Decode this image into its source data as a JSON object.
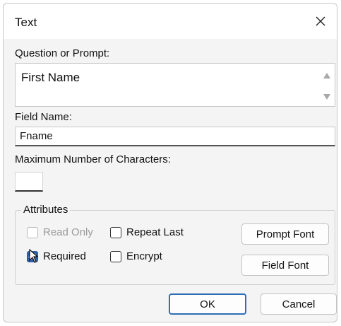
{
  "dialog": {
    "title": "Text",
    "close_icon": "close-icon"
  },
  "prompt": {
    "label": "Question or Prompt:",
    "value": "First Name"
  },
  "field_name": {
    "label": "Field Name:",
    "value": "Fname"
  },
  "max_chars": {
    "label": "Maximum Number of Characters:",
    "value": ""
  },
  "attributes": {
    "label": "Attributes",
    "read_only": {
      "label": "Read Only",
      "checked": false,
      "disabled": true
    },
    "repeat_last": {
      "label": "Repeat Last",
      "checked": false
    },
    "required": {
      "label": "Required",
      "checked": true
    },
    "encrypt": {
      "label": "Encrypt",
      "checked": false
    },
    "prompt_font_label": "Prompt Font",
    "field_font_label": "Field Font"
  },
  "buttons": {
    "ok": "OK",
    "cancel": "Cancel"
  },
  "colors": {
    "accent": "#2f6db5",
    "checked": "#2f5fa0"
  }
}
